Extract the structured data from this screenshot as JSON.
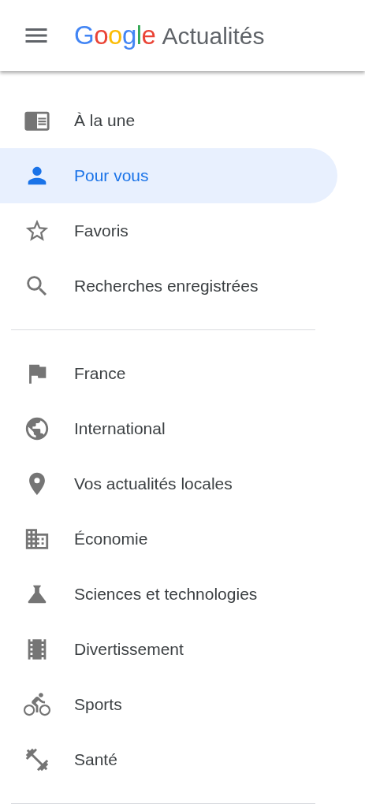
{
  "header": {
    "logo_letters": [
      {
        "text": "G",
        "color": "#4285f4"
      },
      {
        "text": "o",
        "color": "#ea4335"
      },
      {
        "text": "o",
        "color": "#fbbc05"
      },
      {
        "text": "g",
        "color": "#4285f4"
      },
      {
        "text": "l",
        "color": "#34a853"
      },
      {
        "text": "e",
        "color": "#ea4335"
      }
    ],
    "title": "Actualités"
  },
  "sections": [
    {
      "items": [
        {
          "label": "À la une",
          "selected": false
        },
        {
          "label": "Pour vous",
          "selected": true
        },
        {
          "label": "Favoris",
          "selected": false
        },
        {
          "label": "Recherches enregistrées",
          "selected": false
        }
      ]
    },
    {
      "items": [
        {
          "label": "France",
          "selected": false
        },
        {
          "label": "International",
          "selected": false
        },
        {
          "label": "Vos actualités locales",
          "selected": false
        },
        {
          "label": "Économie",
          "selected": false
        },
        {
          "label": "Sciences et technologies",
          "selected": false
        },
        {
          "label": "Divertissement",
          "selected": false
        },
        {
          "label": "Sports",
          "selected": false
        },
        {
          "label": "Santé",
          "selected": false
        }
      ]
    }
  ]
}
